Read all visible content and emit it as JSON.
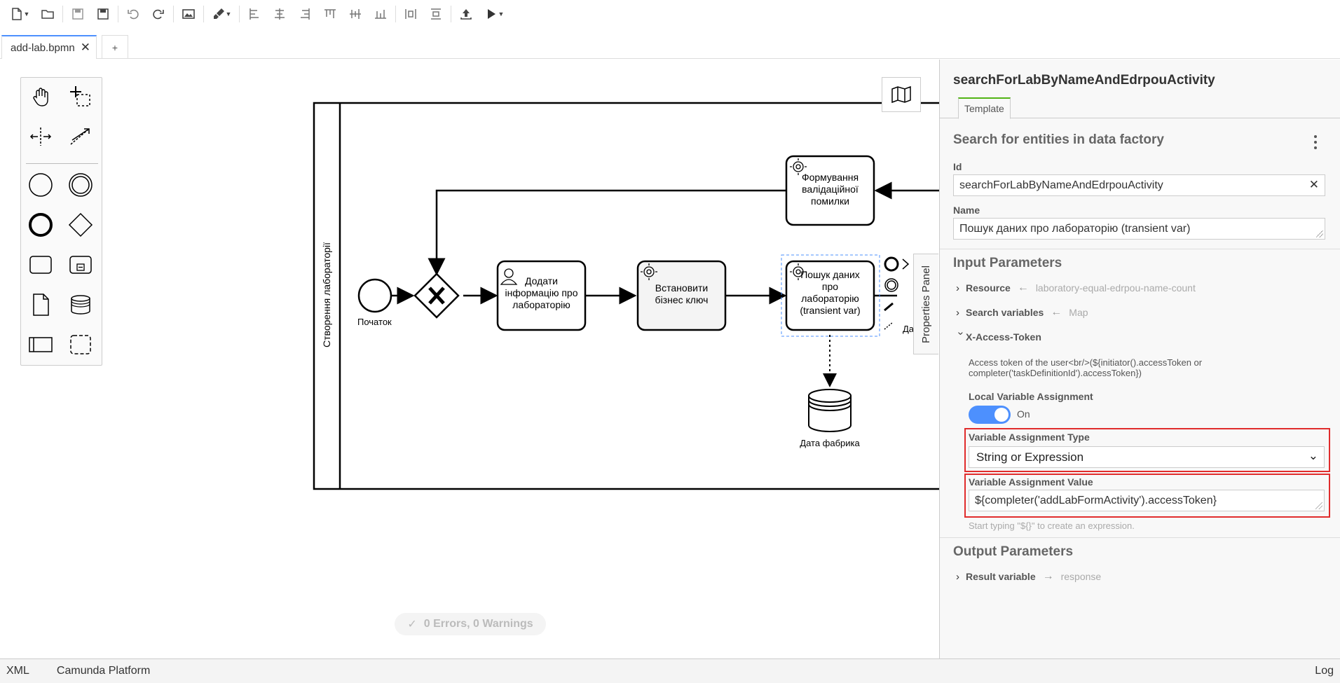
{
  "tabs": [
    {
      "label": "add-lab.bpmn",
      "close": "✕"
    }
  ],
  "tab_add_label": "+",
  "diagram": {
    "lane_title": "Створення лабораторії",
    "start_event_label": "Початок",
    "task_validation": [
      "Формування",
      "валідаційної",
      "помилки"
    ],
    "task_add_info": [
      "Додати",
      "інформацію про",
      "лабораторію"
    ],
    "task_business_key": [
      "Встановити",
      "бізнес ключ"
    ],
    "task_search": [
      "Пошук даних",
      "про",
      "лабораторію",
      "(transient var)"
    ],
    "data_store_label": "Дата фабрика",
    "partial_label": "Да"
  },
  "properties_tab_label": "Properties Panel",
  "validation_status": "0 Errors, 0 Warnings",
  "panel": {
    "title": "searchForLabByNameAndEdrpouActivity",
    "tab": "Template",
    "template_name": "Search for entities in data factory",
    "id_label": "Id",
    "id_value": "searchForLabByNameAndEdrpouActivity",
    "name_label": "Name",
    "name_value": "Пошук даних про лабораторію (transient var)",
    "input_params_title": "Input Parameters",
    "resource_label": "Resource",
    "resource_value": "laboratory-equal-edrpou-name-count",
    "search_vars_label": "Search variables",
    "search_vars_value": "Map",
    "x_access_label": "X-Access-Token",
    "x_access_desc_1": "Access token of the user<br/>(${initiator().accessToken or",
    "x_access_desc_2": "completer('taskDefinitionId').accessToken})",
    "local_var_label": "Local Variable Assignment",
    "toggle_state": "On",
    "var_type_label": "Variable Assignment Type",
    "var_type_value": "String or Expression",
    "var_value_label": "Variable Assignment Value",
    "var_value_value": "${completer('addLabFormActivity').accessToken}",
    "hint": "Start typing \"${}\" to create an expression.",
    "output_params_title": "Output Parameters",
    "result_label": "Result variable",
    "result_value": "response"
  },
  "statusbar": {
    "xml": "XML",
    "platform": "Camunda Platform",
    "log": "Log"
  },
  "colors": {
    "accent": "#4d90fe",
    "highlight": "#e02c2c",
    "tab_green": "#52b415"
  }
}
